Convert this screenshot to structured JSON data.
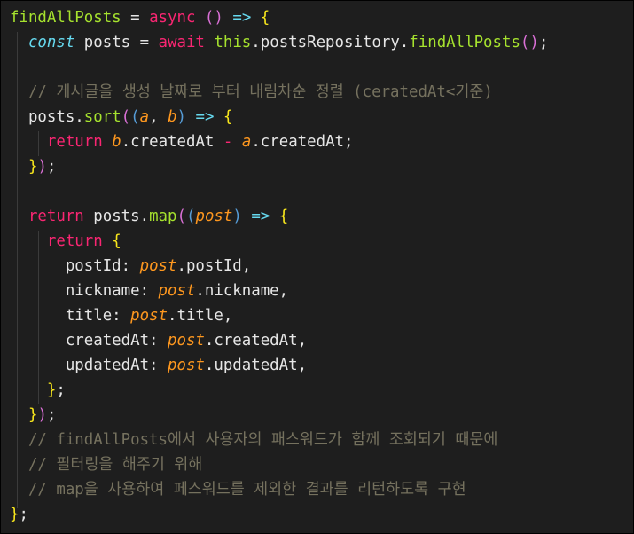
{
  "colors": {
    "background": "#1e1e1e",
    "default": "#e6e6e6",
    "keyword": "#f92672",
    "storage": "#66d9ef",
    "function": "#a6e22e",
    "param": "#fd971f",
    "comment": "#75715e",
    "brace": "#f8e71c",
    "paren": "#da70d6",
    "brace_inner": "#569cd6",
    "guide": "#3b3b3b"
  },
  "code_lines": [
    [
      {
        "t": "findAllPosts",
        "c": "function"
      },
      {
        "t": " = ",
        "c": "default"
      },
      {
        "t": "async",
        "c": "keyword"
      },
      {
        "t": " ",
        "c": "default"
      },
      {
        "t": "()",
        "c": "paren"
      },
      {
        "t": " ",
        "c": "default"
      },
      {
        "t": "=>",
        "c": "storage"
      },
      {
        "t": " ",
        "c": "default"
      },
      {
        "t": "{",
        "c": "brace"
      }
    ],
    [
      {
        "t": "  ",
        "c": "default"
      },
      {
        "t": "const",
        "c": "storage",
        "italic": true
      },
      {
        "t": " posts = ",
        "c": "default"
      },
      {
        "t": "await",
        "c": "keyword"
      },
      {
        "t": " ",
        "c": "default"
      },
      {
        "t": "this",
        "c": "function"
      },
      {
        "t": ".postsRepository.",
        "c": "default"
      },
      {
        "t": "findAllPosts",
        "c": "function"
      },
      {
        "t": "()",
        "c": "paren"
      },
      {
        "t": ";",
        "c": "default"
      }
    ],
    [],
    [
      {
        "t": "  // 게시글을 생성 날짜로 부터 내림차순 정렬 (ceratedAt<기준)",
        "c": "comment"
      }
    ],
    [
      {
        "t": "  posts.",
        "c": "default"
      },
      {
        "t": "sort",
        "c": "function"
      },
      {
        "t": "(",
        "c": "paren"
      },
      {
        "t": "(",
        "c": "brace_inner"
      },
      {
        "t": "a",
        "c": "param",
        "italic": true
      },
      {
        "t": ", ",
        "c": "default"
      },
      {
        "t": "b",
        "c": "param",
        "italic": true
      },
      {
        "t": ")",
        "c": "brace_inner"
      },
      {
        "t": " ",
        "c": "default"
      },
      {
        "t": "=>",
        "c": "storage"
      },
      {
        "t": " ",
        "c": "default"
      },
      {
        "t": "{",
        "c": "brace"
      }
    ],
    [
      {
        "t": "    ",
        "c": "default"
      },
      {
        "t": "return",
        "c": "keyword"
      },
      {
        "t": " ",
        "c": "default"
      },
      {
        "t": "b",
        "c": "param",
        "italic": true
      },
      {
        "t": ".createdAt ",
        "c": "default"
      },
      {
        "t": "-",
        "c": "keyword"
      },
      {
        "t": " ",
        "c": "default"
      },
      {
        "t": "a",
        "c": "param",
        "italic": true
      },
      {
        "t": ".createdAt;",
        "c": "default"
      }
    ],
    [
      {
        "t": "  ",
        "c": "default"
      },
      {
        "t": "}",
        "c": "brace"
      },
      {
        "t": ")",
        "c": "paren"
      },
      {
        "t": ";",
        "c": "default"
      }
    ],
    [],
    [
      {
        "t": "  ",
        "c": "default"
      },
      {
        "t": "return",
        "c": "keyword"
      },
      {
        "t": " posts.",
        "c": "default"
      },
      {
        "t": "map",
        "c": "function"
      },
      {
        "t": "(",
        "c": "paren"
      },
      {
        "t": "(",
        "c": "brace_inner"
      },
      {
        "t": "post",
        "c": "param",
        "italic": true
      },
      {
        "t": ")",
        "c": "brace_inner"
      },
      {
        "t": " ",
        "c": "default"
      },
      {
        "t": "=>",
        "c": "storage"
      },
      {
        "t": " ",
        "c": "default"
      },
      {
        "t": "{",
        "c": "brace"
      }
    ],
    [
      {
        "t": "    ",
        "c": "default"
      },
      {
        "t": "return",
        "c": "keyword"
      },
      {
        "t": " ",
        "c": "default"
      },
      {
        "t": "{",
        "c": "brace"
      }
    ],
    [
      {
        "t": "      postId: ",
        "c": "default"
      },
      {
        "t": "post",
        "c": "param",
        "italic": true
      },
      {
        "t": ".postId,",
        "c": "default"
      }
    ],
    [
      {
        "t": "      nickname: ",
        "c": "default"
      },
      {
        "t": "post",
        "c": "param",
        "italic": true
      },
      {
        "t": ".nickname,",
        "c": "default"
      }
    ],
    [
      {
        "t": "      title: ",
        "c": "default"
      },
      {
        "t": "post",
        "c": "param",
        "italic": true
      },
      {
        "t": ".title,",
        "c": "default"
      }
    ],
    [
      {
        "t": "      createdAt: ",
        "c": "default"
      },
      {
        "t": "post",
        "c": "param",
        "italic": true
      },
      {
        "t": ".createdAt,",
        "c": "default"
      }
    ],
    [
      {
        "t": "      updatedAt: ",
        "c": "default"
      },
      {
        "t": "post",
        "c": "param",
        "italic": true
      },
      {
        "t": ".updatedAt,",
        "c": "default"
      }
    ],
    [
      {
        "t": "    ",
        "c": "default"
      },
      {
        "t": "}",
        "c": "brace"
      },
      {
        "t": ";",
        "c": "default"
      }
    ],
    [
      {
        "t": "  ",
        "c": "default"
      },
      {
        "t": "}",
        "c": "brace"
      },
      {
        "t": ")",
        "c": "paren"
      },
      {
        "t": ";",
        "c": "default"
      }
    ],
    [
      {
        "t": "  // findAllPosts에서 사용자의 패스워드가 함께 조회되기 때문에",
        "c": "comment"
      }
    ],
    [
      {
        "t": "  // 필터링을 해주기 위해",
        "c": "comment"
      }
    ],
    [
      {
        "t": "  // map을 사용하여 페스워드를 제외한 결과를 리턴하도록 구현",
        "c": "comment"
      }
    ],
    [
      {
        "t": "}",
        "c": "brace"
      },
      {
        "t": ";",
        "c": "default"
      }
    ]
  ]
}
